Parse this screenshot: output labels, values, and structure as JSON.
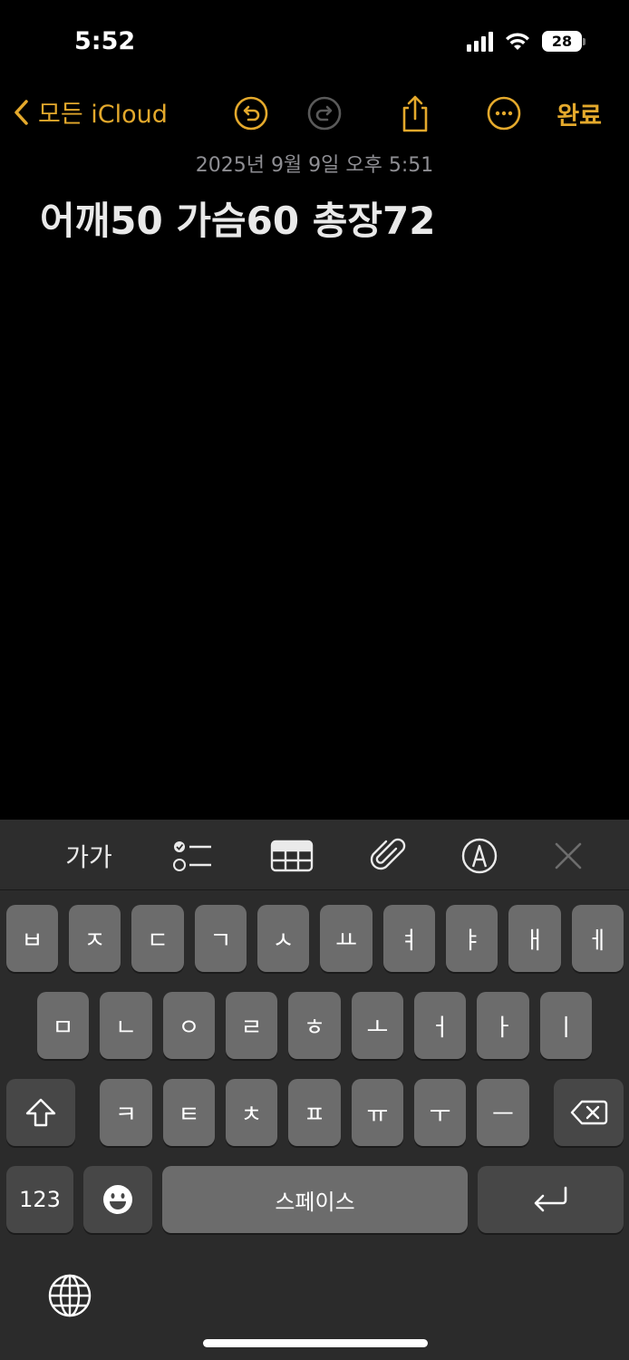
{
  "status_bar": {
    "time": "5:52",
    "battery_level": "28",
    "battery_percent": 28
  },
  "nav": {
    "back_label": "모든 iCloud",
    "done_label": "완료",
    "accent_color": "#e4a92c",
    "icons": [
      "undo-icon",
      "redo-icon",
      "share-icon",
      "more-icon"
    ]
  },
  "note": {
    "date": "2025년 9월 9일 오후 5:51",
    "title": "어깨50 가슴60 총장72"
  },
  "toolbar": {
    "format_label": "가가",
    "icons": [
      "checklist-icon",
      "table-icon",
      "attachment-icon",
      "markup-icon",
      "close-icon"
    ]
  },
  "keyboard": {
    "row1": [
      "ㅂ",
      "ㅈ",
      "ㄷ",
      "ㄱ",
      "ㅅ",
      "ㅛ",
      "ㅕ",
      "ㅑ",
      "ㅐ",
      "ㅔ"
    ],
    "row2": [
      "ㅁ",
      "ㄴ",
      "ㅇ",
      "ㄹ",
      "ㅎ",
      "ㅗ",
      "ㅓ",
      "ㅏ",
      "ㅣ"
    ],
    "row3": [
      "ㅋ",
      "ㅌ",
      "ㅊ",
      "ㅍ",
      "ㅠ",
      "ㅜ",
      "ㅡ"
    ],
    "numbers_label": "123",
    "space_label": "스페이스"
  }
}
